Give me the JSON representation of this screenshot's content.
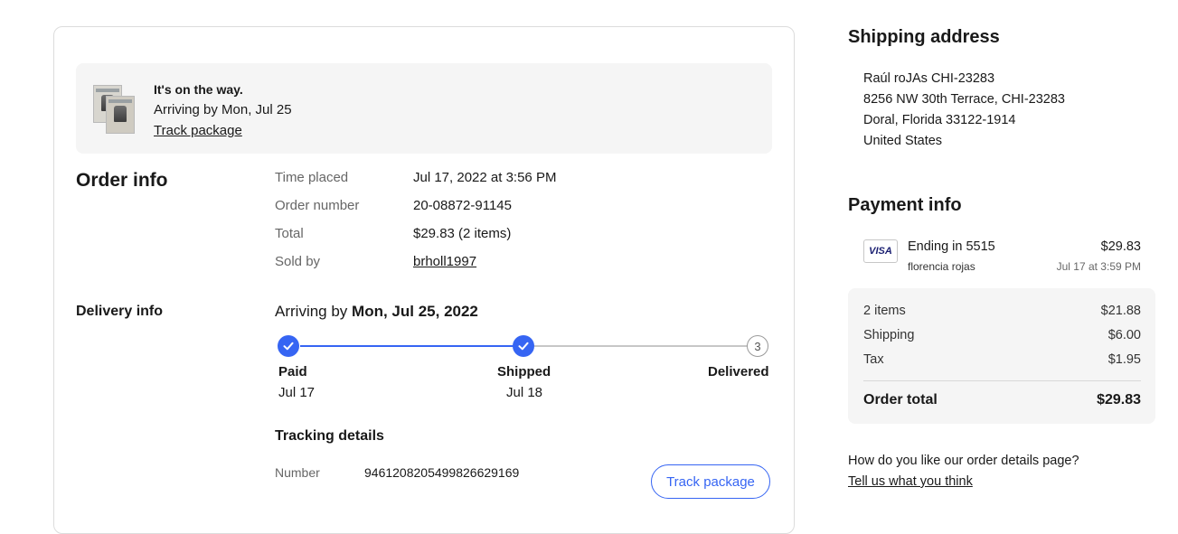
{
  "status": {
    "title": "It's on the way.",
    "eta": "Arriving by Mon, Jul 25",
    "track_link": "Track package"
  },
  "order_info": {
    "heading": "Order info",
    "rows": [
      {
        "label": "Time placed",
        "value": "Jul 17, 2022 at 3:56 PM"
      },
      {
        "label": "Order number",
        "value": "20-08872-91145"
      },
      {
        "label": "Total",
        "value": "$29.83 (2 items)"
      },
      {
        "label": "Sold by",
        "value": "brholl1997"
      }
    ]
  },
  "delivery": {
    "heading": "Delivery info",
    "arriving_prefix": "Arriving by",
    "arriving_date": "Mon, Jul 25, 2022",
    "steps": [
      {
        "label": "Paid",
        "date": "Jul 17",
        "done": true
      },
      {
        "label": "Shipped",
        "date": "Jul 18",
        "done": true
      },
      {
        "label": "Delivered",
        "date": "",
        "number": "3",
        "done": false
      }
    ],
    "tracking_heading": "Tracking details",
    "tracking_label": "Number",
    "tracking_number": "9461208205499826629169",
    "track_button": "Track package"
  },
  "shipping": {
    "heading": "Shipping address",
    "lines": [
      "Raúl roJAs CHI-23283",
      "8256 NW 30th Terrace, CHI-23283",
      "Doral, Florida 33122-1914",
      "United States"
    ]
  },
  "payment": {
    "heading": "Payment info",
    "card_brand": "VISA",
    "ending": "Ending in 5515",
    "name": "florencia rojas",
    "amount": "$29.83",
    "time": "Jul 17 at 3:59 PM",
    "summary": [
      {
        "label": "2 items",
        "value": "$21.88"
      },
      {
        "label": "Shipping",
        "value": "$6.00"
      },
      {
        "label": "Tax",
        "value": "$1.95"
      }
    ],
    "total_label": "Order total",
    "total_value": "$29.83"
  },
  "feedback": {
    "question": "How do you like our order details page?",
    "link": "Tell us what you think"
  },
  "colors": {
    "accent": "#3665f3",
    "panel_bg": "#f5f5f5",
    "progress_pending": "#c7c7c7"
  }
}
